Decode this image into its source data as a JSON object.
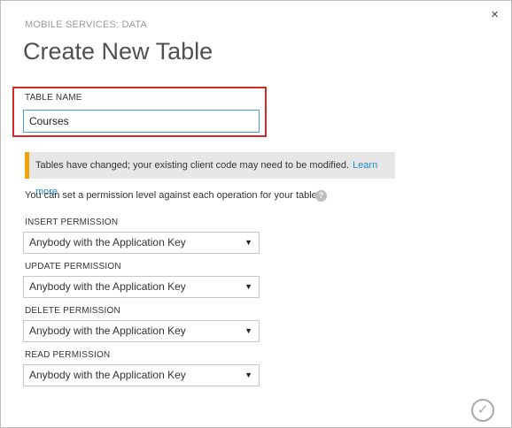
{
  "dialog": {
    "subtitle": "MOBILE SERVICES: DATA",
    "title": "Create New Table",
    "close_label": "×"
  },
  "table_name": {
    "label": "TABLE NAME",
    "value": "Courses"
  },
  "warning": {
    "text": "Tables have changed; your existing client code may need to be modified.",
    "link": "Learn more",
    "accent_color": "#f0a30a"
  },
  "permissions": {
    "intro": "You can set a permission level against each operation for your table.",
    "help_icon": "?",
    "insert": {
      "label": "INSERT PERMISSION",
      "value": "Anybody with the Application Key"
    },
    "update": {
      "label": "UPDATE PERMISSION",
      "value": "Anybody with the Application Key"
    },
    "delete": {
      "label": "DELETE PERMISSION",
      "value": "Anybody with the Application Key"
    },
    "read": {
      "label": "READ PERMISSION",
      "value": "Anybody with the Application Key"
    },
    "dropdown_arrow": "▼"
  },
  "footer": {
    "ok_icon": "✓"
  },
  "colors": {
    "highlight": "#d9262b",
    "input_border": "#4d9de0",
    "link": "#1e87c9"
  }
}
